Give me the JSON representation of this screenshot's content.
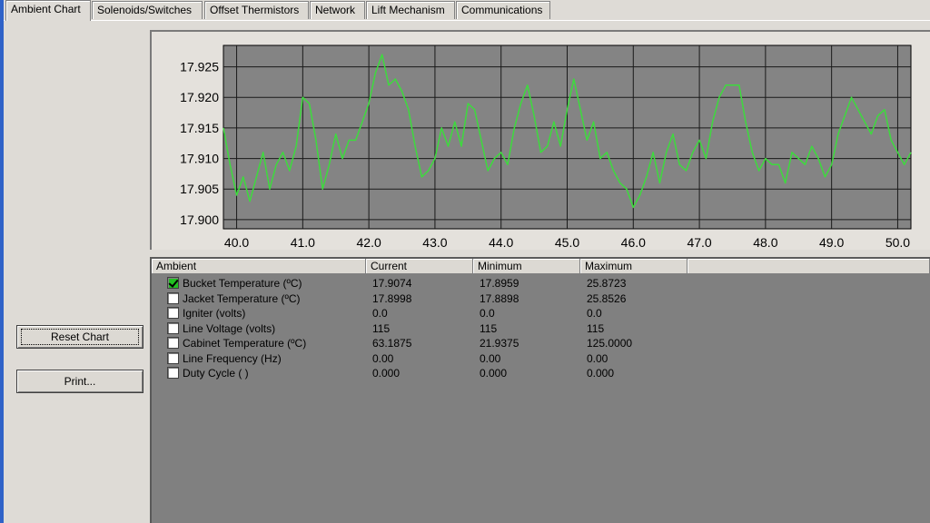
{
  "tabs": [
    {
      "label": "Ambient Chart",
      "active": true
    },
    {
      "label": "Solenoids/Switches",
      "active": false
    },
    {
      "label": "Offset Thermistors",
      "active": false
    },
    {
      "label": "Network",
      "active": false
    },
    {
      "label": "Lift Mechanism",
      "active": false
    },
    {
      "label": "Communications",
      "active": false
    }
  ],
  "buttons": {
    "reset_chart": "Reset Chart",
    "print": "Print..."
  },
  "colors": {
    "line": "#3ddb3d",
    "plot_bg": "#848484",
    "grid": "#1a1a1a"
  },
  "chart_data": {
    "type": "line",
    "xlim": [
      39.8,
      50.2
    ],
    "ylim": [
      17.8985,
      17.9285
    ],
    "x_ticks": [
      40.0,
      41.0,
      42.0,
      43.0,
      44.0,
      45.0,
      46.0,
      47.0,
      48.0,
      49.0,
      50.0
    ],
    "x_tick_labels": [
      "40.0",
      "41.0",
      "42.0",
      "43.0",
      "44.0",
      "45.0",
      "46.0",
      "47.0",
      "48.0",
      "49.0",
      "50.0"
    ],
    "y_ticks": [
      17.9,
      17.905,
      17.91,
      17.915,
      17.92,
      17.925
    ],
    "y_tick_labels": [
      "17.900",
      "17.905",
      "17.910",
      "17.915",
      "17.920",
      "17.925"
    ],
    "grid": true,
    "series": [
      {
        "x": [
          39.8,
          39.9,
          40.0,
          40.1,
          40.2,
          40.3,
          40.4,
          40.5,
          40.6,
          40.7,
          40.8,
          40.9,
          41.0,
          41.1,
          41.2,
          41.3,
          41.4,
          41.5,
          41.6,
          41.7,
          41.8,
          41.9,
          42.0,
          42.1,
          42.2,
          42.3,
          42.4,
          42.5,
          42.6,
          42.7,
          42.8,
          42.9,
          43.0,
          43.1,
          43.2,
          43.3,
          43.4,
          43.5,
          43.6,
          43.7,
          43.8,
          43.9,
          44.0,
          44.1,
          44.2,
          44.3,
          44.4,
          44.5,
          44.6,
          44.7,
          44.8,
          44.9,
          45.0,
          45.1,
          45.2,
          45.3,
          45.4,
          45.5,
          45.6,
          45.7,
          45.8,
          45.9,
          46.0,
          46.1,
          46.2,
          46.3,
          46.4,
          46.5,
          46.6,
          46.7,
          46.8,
          46.9,
          47.0,
          47.1,
          47.2,
          47.3,
          47.4,
          47.5,
          47.6,
          47.7,
          47.8,
          47.9,
          48.0,
          48.1,
          48.2,
          48.3,
          48.4,
          48.5,
          48.6,
          48.7,
          48.8,
          48.9,
          49.0,
          49.1,
          49.2,
          49.3,
          49.4,
          49.5,
          49.6,
          49.7,
          49.8,
          49.9,
          50.0,
          50.1,
          50.2
        ],
        "y": [
          17.915,
          17.909,
          17.904,
          17.907,
          17.903,
          17.907,
          17.911,
          17.905,
          17.909,
          17.911,
          17.908,
          17.912,
          17.92,
          17.919,
          17.913,
          17.905,
          17.909,
          17.914,
          17.91,
          17.913,
          17.913,
          17.916,
          17.919,
          17.924,
          17.927,
          17.922,
          17.923,
          17.921,
          17.918,
          17.912,
          17.907,
          17.908,
          17.91,
          17.915,
          17.912,
          17.916,
          17.912,
          17.919,
          17.918,
          17.913,
          17.908,
          17.91,
          17.911,
          17.909,
          17.915,
          17.919,
          17.922,
          17.917,
          17.911,
          17.912,
          17.916,
          17.912,
          17.918,
          17.923,
          17.918,
          17.913,
          17.916,
          17.91,
          17.911,
          17.908,
          17.906,
          17.905,
          17.902,
          17.904,
          17.907,
          17.911,
          17.906,
          17.911,
          17.914,
          17.909,
          17.908,
          17.911,
          17.913,
          17.91,
          17.916,
          17.92,
          17.922,
          17.922,
          17.922,
          17.916,
          17.911,
          17.908,
          17.91,
          17.909,
          17.909,
          17.906,
          17.911,
          17.91,
          17.909,
          17.912,
          17.91,
          17.907,
          17.909,
          17.914,
          17.917,
          17.92,
          17.918,
          17.916,
          17.914,
          17.917,
          17.918,
          17.913,
          17.911,
          17.909,
          17.911
        ]
      }
    ]
  },
  "table": {
    "headers": [
      "Ambient",
      "Current",
      "Minimum",
      "Maximum"
    ],
    "rows": [
      {
        "label": "Bucket Temperature (ºC)",
        "checked": true,
        "current": "17.9074",
        "minimum": "17.8959",
        "maximum": "25.8723"
      },
      {
        "label": "Jacket Temperature (ºC)",
        "checked": false,
        "current": "17.8998",
        "minimum": "17.8898",
        "maximum": "25.8526"
      },
      {
        "label": "Igniter (volts)",
        "checked": false,
        "current": "0.0",
        "minimum": "0.0",
        "maximum": "0.0"
      },
      {
        "label": "Line Voltage (volts)",
        "checked": false,
        "current": "115",
        "minimum": "115",
        "maximum": "115"
      },
      {
        "label": "Cabinet Temperature (ºC)",
        "checked": false,
        "current": "63.1875",
        "minimum": "21.9375",
        "maximum": "125.0000"
      },
      {
        "label": "Line Frequency (Hz)",
        "checked": false,
        "current": "0.00",
        "minimum": "0.00",
        "maximum": "0.00"
      },
      {
        "label": "Duty Cycle ( )",
        "checked": false,
        "current": "0.000",
        "minimum": "0.000",
        "maximum": "0.000"
      }
    ]
  }
}
